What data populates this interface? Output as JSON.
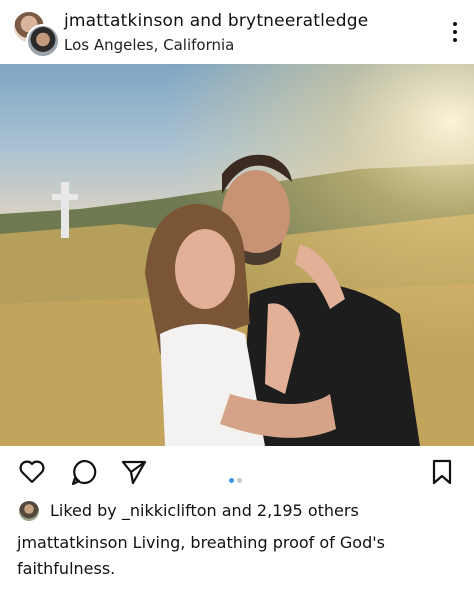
{
  "header": {
    "usernames": "jmattatkinson and brytneeratledge",
    "location": "Los Angeles, California",
    "more_icon": "more-vertical-icon"
  },
  "post": {
    "image_description_icon": "photo",
    "carousel": {
      "active": 1,
      "total": 2,
      "active_color": "#3897f0",
      "inactive_color": "#c7c7c7"
    }
  },
  "actions": {
    "like_icon": "heart-icon",
    "comment_icon": "comment-icon",
    "share_icon": "send-icon",
    "save_icon": "bookmark-icon"
  },
  "likes": {
    "text": "Liked by _nikkiclifton and 2,195 others"
  },
  "caption": {
    "username": "jmattatkinson",
    "text": "Living, breathing proof of God's faithfulness."
  }
}
